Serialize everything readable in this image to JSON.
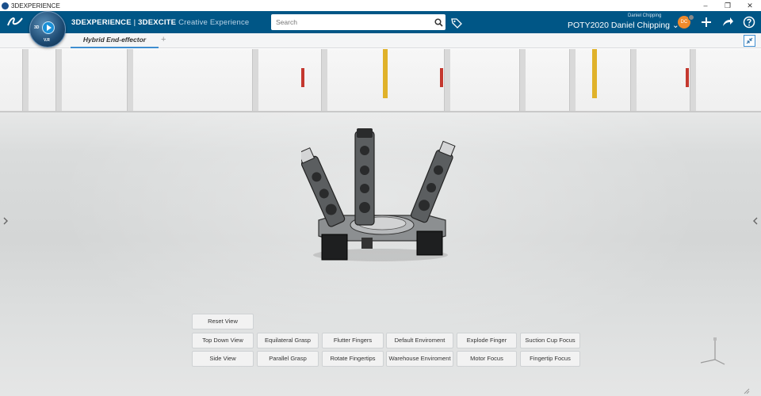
{
  "window": {
    "title": "3DEXPERIENCE",
    "controls": [
      "–",
      "❐",
      "✕"
    ]
  },
  "topbar": {
    "logo": "3DS",
    "brand_primary": "3DEXPERIENCE",
    "brand_separator": " | ",
    "brand_app": "3DEXCITE",
    "brand_suffix": "Creative Experience",
    "search_placeholder": "Search",
    "user_small": "Daniel Chipping",
    "user_label": "POTY2020 Daniel Chipping ⌄",
    "avatar_initials": "DC",
    "icons": [
      "search-icon",
      "tag-icon",
      "add-icon",
      "share-icon",
      "help-icon"
    ],
    "accent_color": "#005686"
  },
  "compass": {
    "label_3d": "3D",
    "label_v": "V.R"
  },
  "tabs": {
    "active": "Hybrid End-effector",
    "add_label": "+"
  },
  "viewer": {
    "left_arrow": "‹",
    "right_arrow": "‹"
  },
  "view_buttons": {
    "reset": "Reset View",
    "top_down": "Top Down View",
    "side": "Side View",
    "equilateral": "Equilateral Grasp",
    "parallel": "Parallel Grasp",
    "flutter": "Flutter Fingers",
    "rotate": "Rotate Fingertips",
    "default_env": "Default Enviroment",
    "warehouse_env": "Warehouse Enviroment",
    "explode": "Explode Finger",
    "motor": "Motor Focus",
    "suction": "Suction Cup Focus",
    "fingertip": "Fingertip Focus"
  }
}
